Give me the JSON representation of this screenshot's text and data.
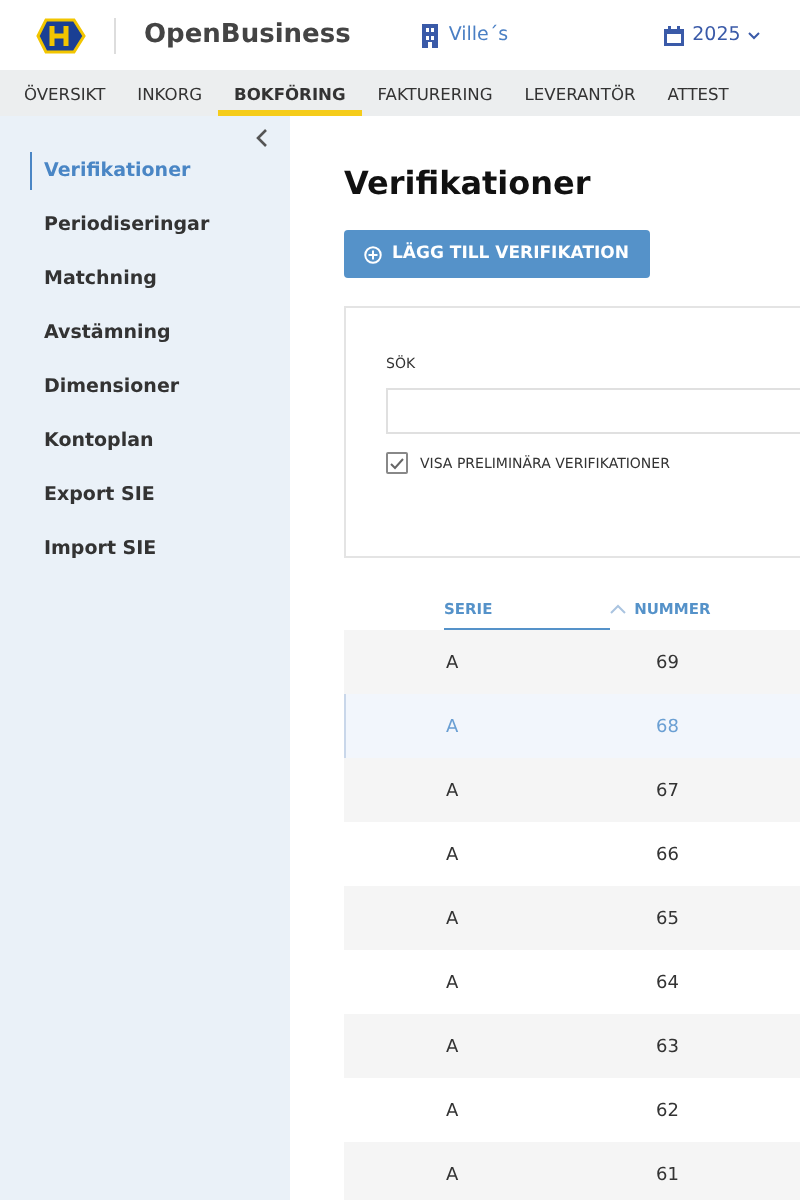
{
  "header": {
    "brand": "OpenBusiness",
    "company": "Ville´s",
    "year": "2025"
  },
  "tabs": [
    {
      "label": "ÖVERSIKT",
      "selected": false
    },
    {
      "label": "INKORG",
      "selected": false
    },
    {
      "label": "BOKFÖRING",
      "selected": true
    },
    {
      "label": "FAKTURERING",
      "selected": false
    },
    {
      "label": "LEVERANTÖR",
      "selected": false
    },
    {
      "label": "ATTEST",
      "selected": false
    }
  ],
  "sidebar": {
    "items": [
      {
        "label": "Verifikationer",
        "selected": true
      },
      {
        "label": "Periodiseringar",
        "selected": false
      },
      {
        "label": "Matchning",
        "selected": false
      },
      {
        "label": "Avstämning",
        "selected": false
      },
      {
        "label": "Dimensioner",
        "selected": false
      },
      {
        "label": "Kontoplan",
        "selected": false
      },
      {
        "label": "Export SIE",
        "selected": false
      },
      {
        "label": "Import SIE",
        "selected": false
      }
    ]
  },
  "page": {
    "title": "Verifikationer",
    "add_button": "LÄGG TILL VERIFIKATION"
  },
  "filter": {
    "search_label": "SÖK",
    "show_preliminary": {
      "label": "VISA PRELIMINÄRA VERIFIKATIONER",
      "checked": true
    }
  },
  "table": {
    "columns": [
      {
        "label": "SERIE",
        "selected": true,
        "sorted": false
      },
      {
        "label": "NUMMER",
        "selected": false,
        "sorted": true
      }
    ],
    "rows": [
      {
        "serie": "A",
        "nummer": "69",
        "selected": false
      },
      {
        "serie": "A",
        "nummer": "68",
        "selected": true
      },
      {
        "serie": "A",
        "nummer": "67",
        "selected": false
      },
      {
        "serie": "A",
        "nummer": "66",
        "selected": false
      },
      {
        "serie": "A",
        "nummer": "65",
        "selected": false
      },
      {
        "serie": "A",
        "nummer": "64",
        "selected": false
      },
      {
        "serie": "A",
        "nummer": "63",
        "selected": false
      },
      {
        "serie": "A",
        "nummer": "62",
        "selected": false
      },
      {
        "serie": "A",
        "nummer": "61",
        "selected": false
      }
    ]
  }
}
